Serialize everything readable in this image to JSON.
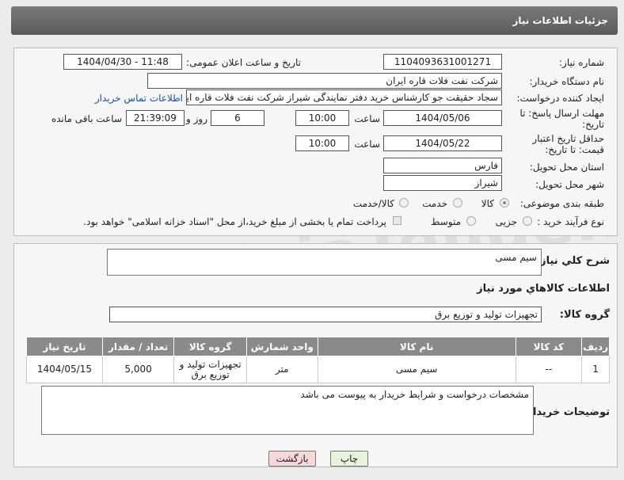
{
  "header": {
    "title": "جزئیات اطلاعات نیاز"
  },
  "form": {
    "need_number_label": "شماره نیاز:",
    "need_number": "1104093631001271",
    "announce_label": "تاریخ و ساعت اعلان عمومی:",
    "announce_value": "1404/04/30 - 11:48",
    "buyer_org_label": "نام دستگاه خریدار:",
    "buyer_org": "شرکت نفت فلات قاره ایران",
    "requester_label": "ایجاد کننده درخواست:",
    "requester": "سجاد حقیقت جو کارشناس خرید دفتر نمایندگی شیراز شرکت نفت فلات قاره ایر",
    "contact_link": "اطلاعات تماس خریدار",
    "reply_deadline_label": "مهلت ارسال پاسخ: تا تاریخ:",
    "reply_date": "1404/05/06",
    "time_label": "ساعت",
    "reply_time": "10:00",
    "days_value": "6",
    "days_and_label": "روز و",
    "remaining_time": "21:39:09",
    "remaining_label": "ساعت باقی مانده",
    "price_validity_label": "حداقل تاریخ اعتبار قیمت: تا تاریخ:",
    "price_date": "1404/05/22",
    "price_time": "10:00",
    "province_label": "استان محل تحویل:",
    "province": "فارس",
    "city_label": "شهر محل تحویل:",
    "city": "شیراز",
    "category_label": "طبقه بندی موضوعی:",
    "category_options": [
      "کالا",
      "خدمت",
      "کالا/خدمت"
    ],
    "category_selected": "کالا",
    "process_label": "نوع فرآیند خرید :",
    "process_options": [
      "جزیی",
      "متوسط"
    ],
    "payment_note": "پرداخت تمام یا بخشی از مبلغ خرید،از محل \"اسناد خزانه اسلامی\" خواهد بود."
  },
  "description": {
    "label": "شرح کلي نياز:",
    "value": "سیم مسی",
    "items_title": "اطلاعات كالاهاي مورد نياز",
    "group_label": "گروه کالا:",
    "group_value": "تجهیزات تولید و توزیع برق"
  },
  "table": {
    "headers": [
      "ردیف",
      "کد کالا",
      "نام کالا",
      "واحد شمارش",
      "گروه کالا",
      "تعداد / مقدار",
      "تاریخ نیاز"
    ],
    "rows": [
      [
        "1",
        "--",
        "سیم مسی",
        "متر",
        "تجهیزات تولید و توزیع برق",
        "5,000",
        "1404/05/15"
      ]
    ]
  },
  "buyer_notes": {
    "label": "توضیحات خریدار:",
    "value": "مشخصات درخواست و شرایط خریدار به پیوست می باشد"
  },
  "buttons": {
    "print": "چاپ",
    "back": "بازگشت"
  },
  "colors": {
    "header": "#666666",
    "back_button": "#f7d9d9",
    "print_button": "#e6f4dc",
    "link": "#1a4fa0"
  }
}
